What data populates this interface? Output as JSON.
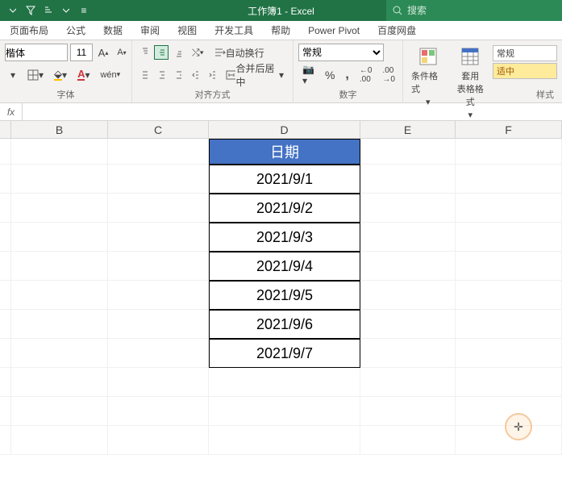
{
  "titlebar": {
    "title": "工作簿1 - Excel",
    "search_placeholder": "搜索"
  },
  "tabs": {
    "layout": "页面布局",
    "formulas": "公式",
    "data": "数据",
    "review": "审阅",
    "view": "视图",
    "developer": "开发工具",
    "help": "帮助",
    "powerpivot": "Power Pivot",
    "baidu": "百度网盘"
  },
  "ribbon": {
    "font": {
      "name": "楷体",
      "size": "11",
      "group_label": "字体"
    },
    "align": {
      "wrap": "自动换行",
      "merge": "合并后居中",
      "group_label": "对齐方式"
    },
    "number": {
      "format": "常规",
      "group_label": "数字"
    },
    "styles": {
      "cond_fmt": "条件格式",
      "table_fmt": "套用\n表格格式",
      "normal": "常规",
      "neutral": "适中",
      "group_label": "样式"
    }
  },
  "formula_bar": {
    "fx": "fx",
    "value": ""
  },
  "grid": {
    "columns": [
      "B",
      "C",
      "D",
      "E",
      "F"
    ],
    "d_header": "日期",
    "d_values": [
      "2021/9/1",
      "2021/9/2",
      "2021/9/3",
      "2021/9/4",
      "2021/9/5",
      "2021/9/6",
      "2021/9/7"
    ]
  }
}
